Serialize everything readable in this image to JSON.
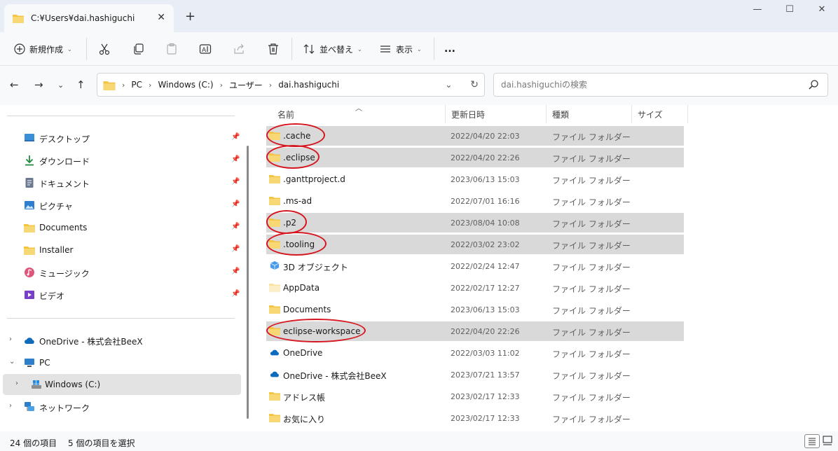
{
  "window": {
    "tab_title": "C:¥Users¥dai.hashiguchi",
    "colors": {
      "folder": "#f4c542",
      "accent": "#0067c0",
      "selected_row": "#d9d9d9",
      "annotation": "#d6161e"
    }
  },
  "toolbar": {
    "new_label": "新規作成",
    "sort_label": "並べ替え",
    "view_label": "表示",
    "more_label": "..."
  },
  "address": {
    "crumbs": [
      "PC",
      "Windows (C:)",
      "ユーザー",
      "dai.hashiguchi"
    ]
  },
  "search": {
    "placeholder": "dai.hashiguchiの検索"
  },
  "nav": {
    "quick_access": [
      {
        "label": "デスクトップ",
        "icon": "desktop-icon"
      },
      {
        "label": "ダウンロード",
        "icon": "download-icon"
      },
      {
        "label": "ドキュメント",
        "icon": "document-icon"
      },
      {
        "label": "ピクチャ",
        "icon": "picture-icon"
      },
      {
        "label": "Documents",
        "icon": "folder-icon"
      },
      {
        "label": "Installer",
        "icon": "folder-icon"
      },
      {
        "label": "ミュージック",
        "icon": "music-icon"
      },
      {
        "label": "ビデオ",
        "icon": "video-icon"
      }
    ],
    "tree": [
      {
        "label": "OneDrive - 株式会社BeeX",
        "icon": "cloud-icon"
      },
      {
        "label": "PC",
        "icon": "computer-icon"
      },
      {
        "label": "Windows (C:)",
        "icon": "drive-icon"
      },
      {
        "label": "ネットワーク",
        "icon": "network-icon"
      }
    ]
  },
  "columns": {
    "name": "名前",
    "date": "更新日時",
    "type": "種類",
    "size": "サイズ"
  },
  "files": [
    {
      "name": ".cache",
      "date": "2022/04/20 22:03",
      "type": "ファイル フォルダー"
    },
    {
      "name": ".eclipse",
      "date": "2022/04/20 22:26",
      "type": "ファイル フォルダー"
    },
    {
      "name": ".ganttproject.d",
      "date": "2023/06/13 15:03",
      "type": "ファイル フォルダー"
    },
    {
      "name": ".ms-ad",
      "date": "2022/07/01 16:16",
      "type": "ファイル フォルダー"
    },
    {
      "name": ".p2",
      "date": "2023/08/04 10:08",
      "type": "ファイル フォルダー"
    },
    {
      "name": ".tooling",
      "date": "2022/03/02 23:02",
      "type": "ファイル フォルダー"
    },
    {
      "name": "3D オブジェクト",
      "date": "2022/02/24 12:47",
      "type": "ファイル フォルダー"
    },
    {
      "name": "AppData",
      "date": "2022/02/17 12:27",
      "type": "ファイル フォルダー"
    },
    {
      "name": "Documents",
      "date": "2023/06/13 15:03",
      "type": "ファイル フォルダー"
    },
    {
      "name": "eclipse-workspace",
      "date": "2022/04/20 22:26",
      "type": "ファイル フォルダー"
    },
    {
      "name": "OneDrive",
      "date": "2022/03/03 11:02",
      "type": "ファイル フォルダー"
    },
    {
      "name": "OneDrive - 株式会社BeeX",
      "date": "2023/07/21 13:57",
      "type": "ファイル フォルダー"
    },
    {
      "name": "アドレス帳",
      "date": "2023/02/17 12:33",
      "type": "ファイル フォルダー"
    },
    {
      "name": "お気に入り",
      "date": "2023/02/17 12:33",
      "type": "ファイル フォルダー"
    }
  ],
  "status": {
    "count": "24 個の項目",
    "selected": "5 個の項目を選択"
  }
}
